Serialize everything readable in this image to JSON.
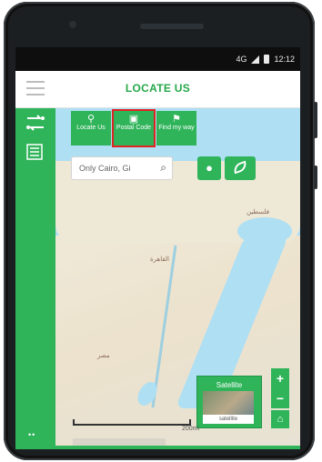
{
  "status_bar": {
    "network": "4G",
    "time": "12:12"
  },
  "app_bar": {
    "title": "LOCATE US"
  },
  "tiles": [
    {
      "label": "Locate Us",
      "icon": "location-pin-icon",
      "selected": false
    },
    {
      "label": "Postal Code",
      "icon": "building-icon",
      "selected": true
    },
    {
      "label": "Find my way",
      "icon": "route-icon",
      "selected": false
    }
  ],
  "search": {
    "value": "Only Cairo, Gi"
  },
  "map": {
    "places": [
      "القاهرة",
      "مصر",
      "فلسطين"
    ],
    "layer_label": "Satellite",
    "layer_caption": "satellite",
    "scale": "200mi",
    "zoom_in": "+",
    "zoom_out": "−"
  },
  "rail": {
    "more": "••"
  },
  "colors": {
    "accent": "#2fb45a",
    "title": "#27a84a",
    "selected_outline": "#e02424"
  }
}
